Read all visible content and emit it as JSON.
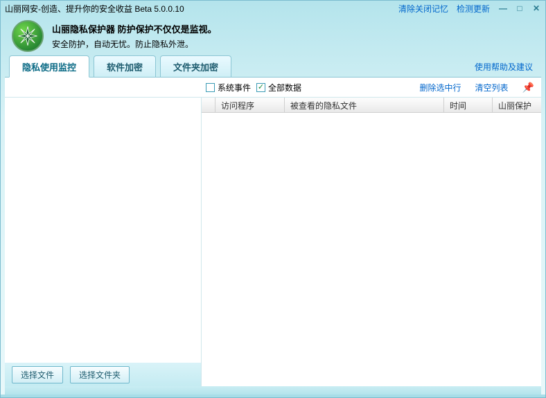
{
  "window": {
    "title": "山丽网安-创造、提升你的安全收益 Beta 5.0.0.10"
  },
  "titlebar_links": {
    "clear_close_memory": "清除关闭记忆",
    "check_update": "检测更新"
  },
  "banner": {
    "headline": "山丽隐私保护器 防护保护不仅仅是监视。",
    "subline": "安全防护，自动无忧。防止隐私外泄。"
  },
  "tabs": [
    {
      "label": "隐私使用监控",
      "active": true
    },
    {
      "label": "软件加密",
      "active": false
    },
    {
      "label": "文件夹加密",
      "active": false
    }
  ],
  "help_link": "使用帮助及建议",
  "checkboxes": {
    "system_events": {
      "label": "系统事件",
      "checked": false
    },
    "all_data": {
      "label": "全部数据",
      "checked": true
    }
  },
  "toolbar_links": {
    "delete_selected": "删除选中行",
    "clear_list": "清空列表"
  },
  "columns": {
    "program": "访问程序",
    "viewed_file": "被查看的隐私文件",
    "time": "时间",
    "protect": "山丽保护"
  },
  "left_buttons": {
    "select_file": "选择文件",
    "select_folder": "选择文件夹"
  }
}
